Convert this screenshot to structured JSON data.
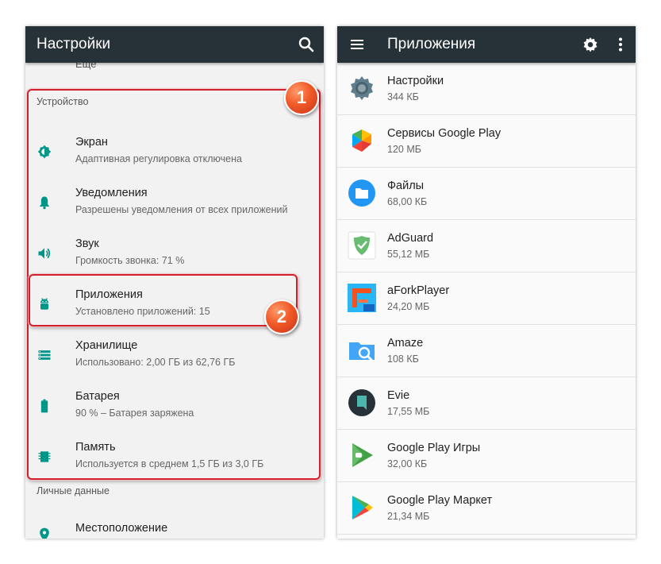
{
  "left_screen": {
    "title": "Настройки",
    "cut_item": "Еще",
    "device_section": "Устройство",
    "items": [
      {
        "title": "Экран",
        "subtitle": "Адаптивная регулировка отключена",
        "icon": "brightness-icon"
      },
      {
        "title": "Уведомления",
        "subtitle": "Разрешены уведомления от всех приложений",
        "icon": "bell-icon"
      },
      {
        "title": "Звук",
        "subtitle": "Громкость звонка: 71 %",
        "icon": "volume-icon"
      },
      {
        "title": "Приложения",
        "subtitle": "Установлено приложений: 15",
        "icon": "android-icon"
      },
      {
        "title": "Хранилище",
        "subtitle": "Использовано: 2,00 ГБ из 62,76 ГБ",
        "icon": "storage-icon"
      },
      {
        "title": "Батарея",
        "subtitle": "90 % – Батарея заряжена",
        "icon": "battery-icon"
      },
      {
        "title": "Память",
        "subtitle": "Используется в среднем 1,5 ГБ из 3,0 ГБ",
        "icon": "memory-icon"
      }
    ],
    "personal_section": "Личные данные",
    "location_item": "Местоположение"
  },
  "right_screen": {
    "title": "Приложения",
    "apps": [
      {
        "name": "Настройки",
        "size": "344 КБ",
        "icon": "settings-gear-icon"
      },
      {
        "name": "Сервисы Google Play",
        "size": "120 МБ",
        "icon": "google-play-services-icon"
      },
      {
        "name": "Файлы",
        "size": "68,00 КБ",
        "icon": "files-icon"
      },
      {
        "name": "AdGuard",
        "size": "55,12 МБ",
        "icon": "adguard-icon"
      },
      {
        "name": "aForkPlayer",
        "size": "24,20 МБ",
        "icon": "aforkplayer-icon"
      },
      {
        "name": "Amaze",
        "size": "108 КБ",
        "icon": "amaze-icon"
      },
      {
        "name": "Evie",
        "size": "17,55 МБ",
        "icon": "evie-icon"
      },
      {
        "name": "Google Play Игры",
        "size": "32,00 КБ",
        "icon": "google-play-games-icon"
      },
      {
        "name": "Google Play Маркет",
        "size": "21,34 МБ",
        "icon": "google-play-store-icon"
      }
    ]
  },
  "annotations": {
    "badge1": "1",
    "badge2": "2"
  },
  "colors": {
    "appbar": "#263238",
    "accent": "#009688",
    "highlight": "#d0222e"
  }
}
